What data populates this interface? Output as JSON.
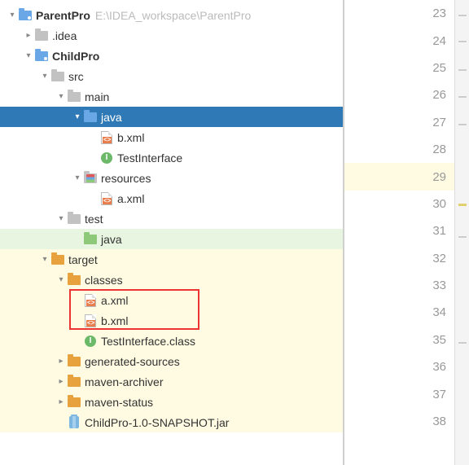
{
  "tree": {
    "root": {
      "name": "ParentPro",
      "path": "E:\\IDEA_workspace\\ParentPro"
    },
    "idea": ".idea",
    "child": "ChildPro",
    "src": "src",
    "main": "main",
    "java": "java",
    "b_xml": "b.xml",
    "test_iface": "TestInterface",
    "resources": "resources",
    "a_xml": "a.xml",
    "test": "test",
    "java2": "java",
    "target": "target",
    "classes": "classes",
    "cls_a": "a.xml",
    "cls_b": "b.xml",
    "cls_iface": "TestInterface.class",
    "gen": "generated-sources",
    "marchiver": "maven-archiver",
    "mstatus": "maven-status",
    "jar": "ChildPro-1.0-SNAPSHOT.jar"
  },
  "gutter": {
    "start": 23,
    "end": 38,
    "highlight": 29
  }
}
